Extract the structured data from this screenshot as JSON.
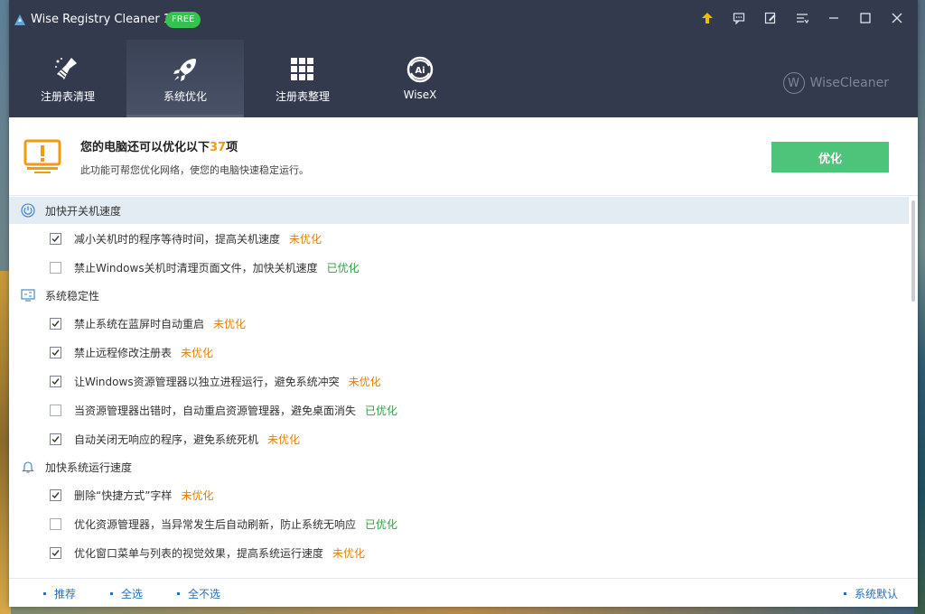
{
  "window": {
    "title": "Wise Registry Cleaner 11",
    "badge": "FREE"
  },
  "tabs": [
    {
      "label": "注册表清理",
      "icon": "broom-icon"
    },
    {
      "label": "系统优化",
      "icon": "rocket-icon"
    },
    {
      "label": "注册表整理",
      "icon": "grid-icon"
    },
    {
      "label": "WiseX",
      "icon": "ai-logo-icon"
    }
  ],
  "brand": {
    "letter": "W",
    "name": "WiseCleaner"
  },
  "banner": {
    "headline_prefix": "您的电脑还可以优化以下",
    "count": "37",
    "headline_suffix": "项",
    "subline": "此功能可帮您优化网络，使您的电脑快速稳定运行。",
    "button": "优化"
  },
  "categories": [
    {
      "title": "加快开关机速度",
      "items": [
        {
          "text": "减小关机时的程序等待时间，提高关机速度",
          "status": "未优化"
        },
        {
          "text": "禁止Windows关机时清理页面文件，加快关机速度",
          "status": "已优化"
        }
      ]
    },
    {
      "title": "系统稳定性",
      "items": [
        {
          "text": "禁止系统在蓝屏时自动重启",
          "status": "未优化"
        },
        {
          "text": "禁止远程修改注册表",
          "status": "未优化"
        },
        {
          "text": "让Windows资源管理器以独立进程运行，避免系统冲突",
          "status": "未优化"
        },
        {
          "text": "当资源管理器出错时，自动重启资源管理器，避免桌面消失",
          "status": "已优化"
        },
        {
          "text": "自动关闭无响应的程序，避免系统死机",
          "status": "未优化"
        }
      ]
    },
    {
      "title": "加快系统运行速度",
      "items": [
        {
          "text": "删除“快捷方式”字样",
          "status": "未优化"
        },
        {
          "text": "优化资源管理器，当异常发生后自动刷新，防止系统无响应",
          "status": "已优化"
        },
        {
          "text": "优化窗口菜单与列表的视觉效果，提高系统运行速度",
          "status": "未优化"
        }
      ]
    }
  ],
  "footer": {
    "recommend": "推荐",
    "select_all": "全选",
    "select_none": "全不选",
    "system_default": "系统默认"
  },
  "colors": {
    "titlebar": "#333a4d",
    "accent_green": "#4dc47a",
    "pending": "#e0810c",
    "done": "#2ea043",
    "count": "#f29a12",
    "link": "#2b6fb5"
  }
}
